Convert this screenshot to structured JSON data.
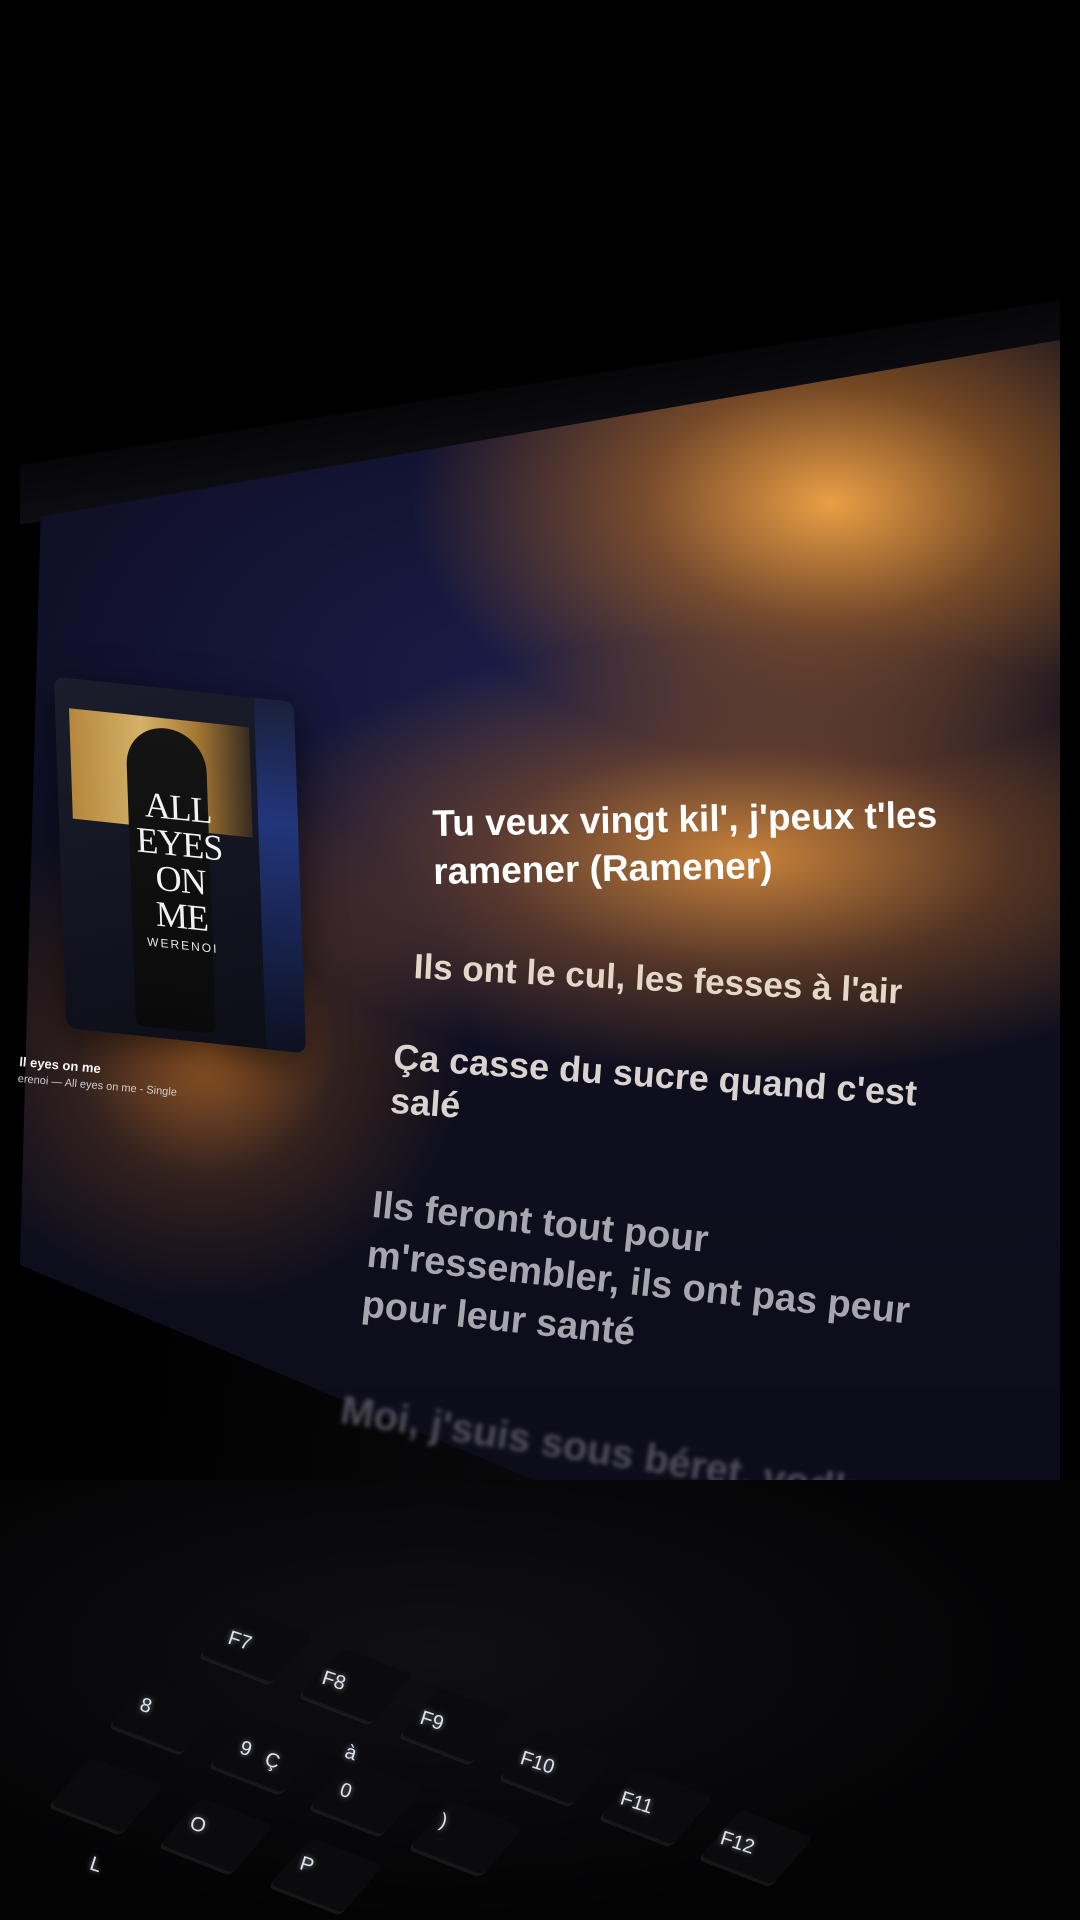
{
  "album": {
    "title": "ALL\nEYES\nON\nME",
    "artist": "WERENOI"
  },
  "track": {
    "title": "ll eyes on me",
    "subtitle": "erenoi — All eyes on me - Single"
  },
  "lyrics": [
    {
      "text": "Tu veux vingt kil', j'peux t'les\nramener (Ramener)",
      "state": "current"
    },
    {
      "text": "Ils ont le cul, les fesses à l'air",
      "state": "upcoming"
    },
    {
      "text": "Ça casse du sucre quand c'est\nsalé",
      "state": "upcoming"
    },
    {
      "text": "Ils feront tout pour\nm'ressembler, ils ont pas peur\npour leur santé",
      "state": "upcoming"
    },
    {
      "text": "Moi, j'suis sous béret, vodka",
      "state": "faded"
    }
  ],
  "keyboard": {
    "visible_keys": [
      "F7",
      "F8",
      "F9",
      "F10",
      "F11",
      "F12",
      "8",
      "9",
      "0",
      "Ç",
      "à",
      "O",
      "P",
      ")",
      "L"
    ]
  }
}
